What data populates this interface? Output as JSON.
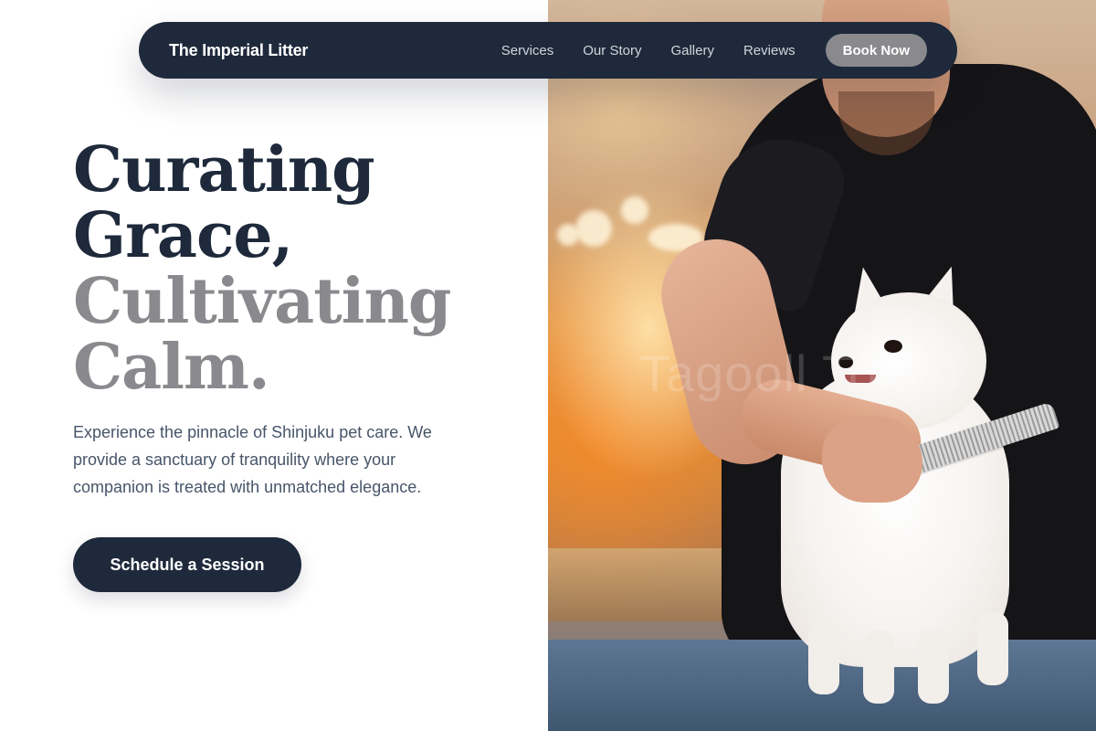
{
  "nav": {
    "brand": "The Imperial Litter",
    "links": [
      "Services",
      "Our Story",
      "Gallery",
      "Reviews"
    ],
    "cta_label": "Book Now"
  },
  "hero": {
    "headline_lines": [
      "Curating",
      "Grace,",
      "Cultivating",
      "Calm."
    ],
    "description": "Experience the pinnacle of Shinjuku pet care. We provide a sanctuary of tranquility where your companion is treated with unmatched elegance.",
    "cta_label": "Schedule a Session",
    "image_watermark": "Tagooll Tokyo"
  },
  "colors": {
    "navy": "#1e293b",
    "grey_accent": "#8a8a8e",
    "body_text": "#475569"
  }
}
